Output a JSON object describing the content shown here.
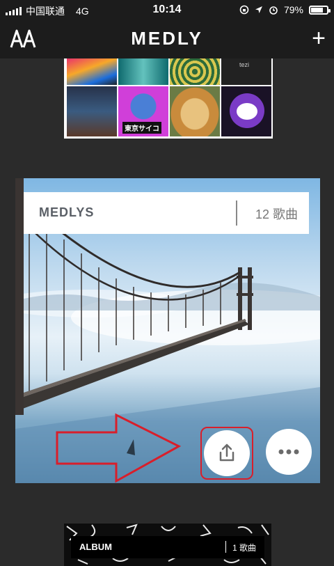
{
  "status_bar": {
    "carrier": "中国联通",
    "network": "4G",
    "time": "10:14",
    "battery": "79%",
    "battery_level": 0.79
  },
  "nav": {
    "title": "MEDLY"
  },
  "collage": {
    "tile_label": "東京サイコ",
    "tile_text": "tezi"
  },
  "card": {
    "name": "MEDLYS",
    "count": "12 歌曲"
  },
  "album": {
    "name": "ALBUM",
    "count": "1 歌曲"
  },
  "icons": {
    "fonts": "aa-icon",
    "add": "plus-icon",
    "share": "share-icon",
    "more": "more-icon",
    "annotation": "arrow-annotation"
  },
  "colors": {
    "annotation_red": "#d91e2a",
    "header_bg": "#1c1c1c",
    "page_bg": "#2b2b2b"
  }
}
